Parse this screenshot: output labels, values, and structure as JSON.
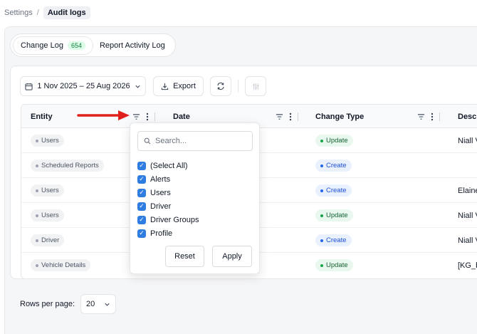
{
  "breadcrumb": {
    "parent": "Settings",
    "separator": "/",
    "current": "Audit logs"
  },
  "tabs": [
    {
      "label": "Change Log",
      "count": "654",
      "active": true
    },
    {
      "label": "Report Activity Log",
      "active": false
    }
  ],
  "toolbar": {
    "date_range": "1 Nov 2025 – 25 Aug 2026",
    "export_label": "Export",
    "icons": {
      "calendar": "calendar-icon",
      "export": "download-icon",
      "refresh": "refresh-icon",
      "columns": "columns-icon"
    }
  },
  "table": {
    "columns": [
      "Entity",
      "Date",
      "Change Type",
      "Descr"
    ],
    "rows": [
      {
        "entity": "Users",
        "change_type": "Update",
        "description": "Niall V"
      },
      {
        "entity": "Scheduled Reports",
        "change_type": "Create",
        "description": ""
      },
      {
        "entity": "Users",
        "change_type": "Create",
        "description": "Elaine"
      },
      {
        "entity": "Users",
        "change_type": "Update",
        "description": "Niall V"
      },
      {
        "entity": "Driver",
        "change_type": "Create",
        "description": "Niall V"
      },
      {
        "entity": "Vehicle Details",
        "change_type": "Update",
        "description": "[KG_b"
      }
    ]
  },
  "filter_dropdown": {
    "search_placeholder": "Search...",
    "options": [
      {
        "label": "(Select All)",
        "checked": true
      },
      {
        "label": "Alerts",
        "checked": true
      },
      {
        "label": "Users",
        "checked": true
      },
      {
        "label": "Driver",
        "checked": true
      },
      {
        "label": "Driver Groups",
        "checked": true
      },
      {
        "label": "Profile",
        "checked": true
      }
    ],
    "reset_label": "Reset",
    "apply_label": "Apply"
  },
  "pagination": {
    "rows_per_page_label": "Rows per page:",
    "rows_per_page_value": "20"
  },
  "colors": {
    "accent": "#2f7de1",
    "update": "#16a34a",
    "create": "#2563eb",
    "arrow": "#e0201b"
  }
}
